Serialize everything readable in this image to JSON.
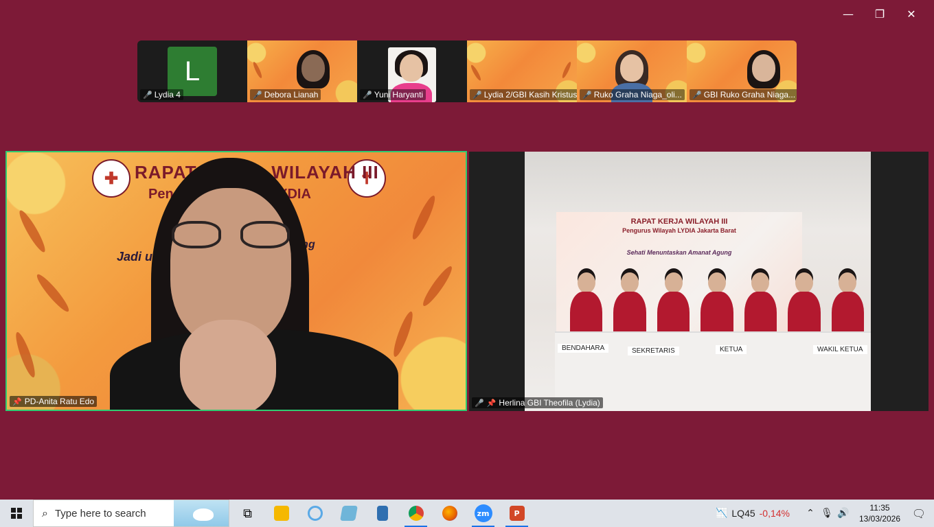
{
  "window_controls": {
    "minimize": "—",
    "restore": "❐",
    "close": "✕"
  },
  "gallery": [
    {
      "name": "Lydia 4",
      "avatar_letter": "L"
    },
    {
      "name": "Debora Lianah"
    },
    {
      "name": "Yuni Haryanti"
    },
    {
      "name": "Lydia 2/GBI Kasih Kristus"
    },
    {
      "name": "Ruko Graha Niaga_oli..."
    },
    {
      "name": "GBI Ruko Graha Niaga..."
    }
  ],
  "tile_left": {
    "participant": "PD-Anita Ratu Edo",
    "bg_line1": "RAPAT KERJA WILAYAH III",
    "bg_line2": "Pengurus Wilayah LYDIA",
    "bg_line3": "at Agung",
    "bg_line4": "Jadi                 urid Tuhan"
  },
  "tile_right": {
    "participant": "Herlina GBI Theofila (Lydia)",
    "banner_line1": "RAPAT KERJA WILAYAH III",
    "banner_line2": "Pengurus Wilayah LYDIA Jakarta Barat",
    "banner_line3": "Sehati Menuntaskan Amanat Agung",
    "placards": [
      "BENDAHARA",
      "SEKRETARIS",
      "KETUA",
      "WAKIL KETUA"
    ]
  },
  "taskbar": {
    "search_placeholder": "Type here to search",
    "stock_name": "LQ45",
    "stock_change": "-0,14%",
    "time": "11:35",
    "date": "13/03/2026",
    "accent": "#1a73e8"
  }
}
